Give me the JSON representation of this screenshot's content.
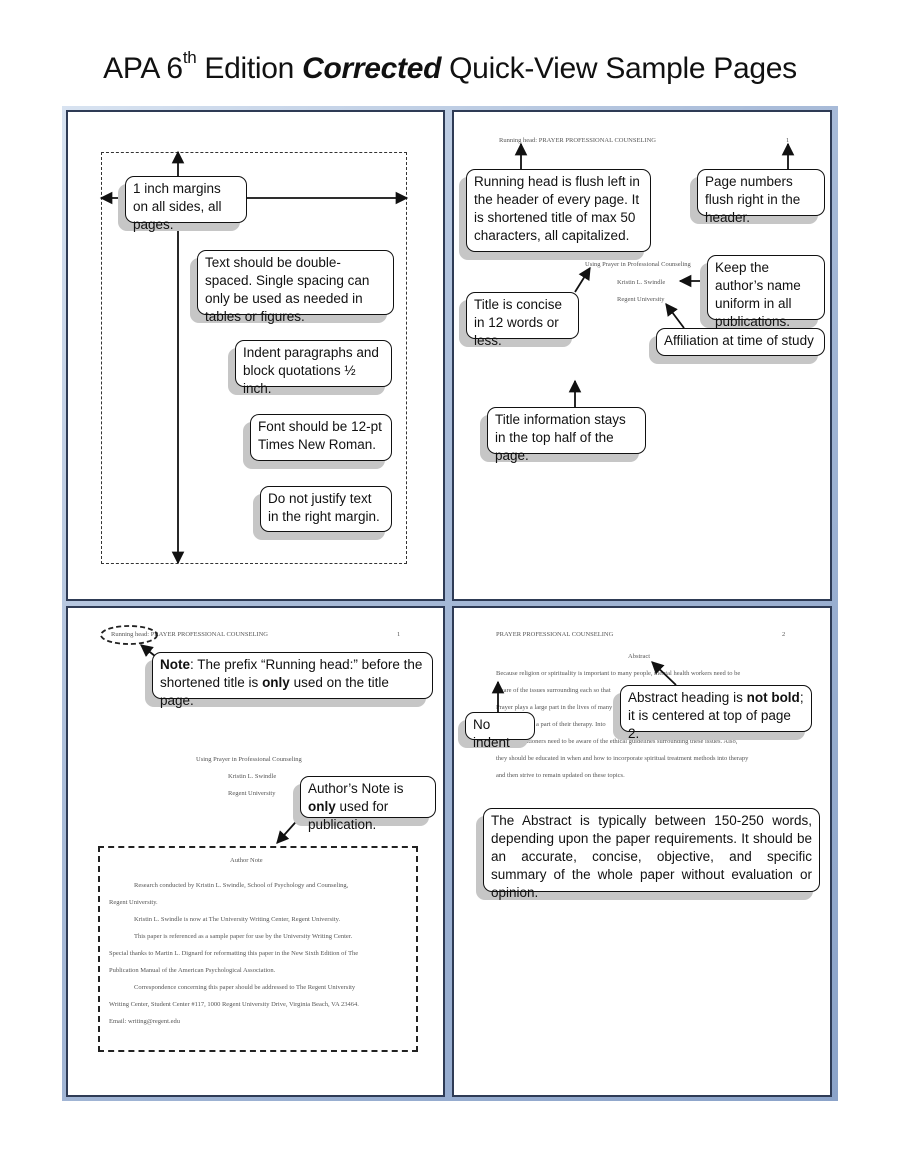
{
  "header": {
    "title_pre": "APA 6",
    "title_sup": "th",
    "title_mid": " Edition ",
    "title_bold": "Corrected",
    "title_post": " Quick-View Sample Pages"
  },
  "page1": {
    "callouts": [
      "1 inch margins on all sides, all pages.",
      "Text should be double-spaced. Single spacing can only be used as needed in tables or figures.",
      "Indent paragraphs and block quotations ½ inch.",
      "Font should be 12-pt Times New Roman.",
      "Do not justify text in the right margin."
    ]
  },
  "page2": {
    "running_head": "Running head: PRAYER PROFESSIONAL COUNSELING",
    "page_number": "1",
    "title_lines": [
      "Using Prayer in Professional Counseling",
      "Kristin L. Swindle",
      "Regent University"
    ],
    "callouts": {
      "running_head": "Running head is flush left in the header of every page. It is shortened title of max 50 characters, all capitalized.",
      "page_numbers": "Page numbers flush right in the header.",
      "author_name": "Keep the author’s name uniform in all publications.",
      "title_concise": "Title is concise in 12 words or less.",
      "affiliation": "Affiliation at time of study",
      "top_half": "Title information stays in the top half of the page."
    }
  },
  "page3": {
    "running_head_prefix": "Running head:",
    "running_head_rest": " PRAYER PROFESSIONAL COUNSELING",
    "page_number": "1",
    "title_lines": [
      "Using Prayer in Professional Counseling",
      "Kristin L. Swindle",
      "Regent University"
    ],
    "note_callout": {
      "bold1": "Note",
      "text1": ": The prefix “Running head:” before the shortened title is ",
      "bold2": "only",
      "text2": " used on the title page."
    },
    "author_note_callout": {
      "text1": "Author’s Note is ",
      "bold": "only",
      "text2": " used for publication."
    },
    "author_note": {
      "heading": "Author Note",
      "lines": [
        "Research conducted by Kristin L. Swindle, School of Psychology and Counseling,",
        "Regent University.",
        "Kristin L. Swindle is now at The University Writing Center, Regent University.",
        "This paper is referenced as a sample paper for use by the University Writing Center.",
        "Special thanks to Martin L. Dignard for reformatting this paper in the New Sixth Edition of The",
        "Publication Manual of the American Psychological Association.",
        "Correspondence concerning this paper should be addressed to The Regent University",
        "Writing Center, Student Center #117, 1000 Regent University Drive, Virginia Beach, VA 23464.",
        "Email: writing@regent.edu"
      ]
    }
  },
  "page4": {
    "running_head": "PRAYER PROFESSIONAL COUNSELING",
    "page_number": "2",
    "abstract_heading": "Abstract",
    "abstract_lines": [
      "Because religion or spirituality is important to many people, mental health workers need to be",
      "aware of the issues surrounding each so that",
      "Prayer plays a large part in the lives of many",
      "a part of their therapy. Into",
      "health practitioners need to be aware of the ethical guidelines surrounding these issues. Also,",
      "they should be educated in when and how to incorporate spiritual treatment methods into therapy",
      "and then strive to remain updated on these topics."
    ],
    "no_indent_callout": "No indent",
    "heading_callout": {
      "text1": "Abstract heading is ",
      "bold": "not bold",
      "text2": "; it is centered at top of page 2."
    },
    "abstract_callout": "The Abstract is typically between 150-250 words, depending upon the paper requirements. It should be an accurate, concise, objective, and specific summary of the whole paper without evaluation or opinion."
  }
}
